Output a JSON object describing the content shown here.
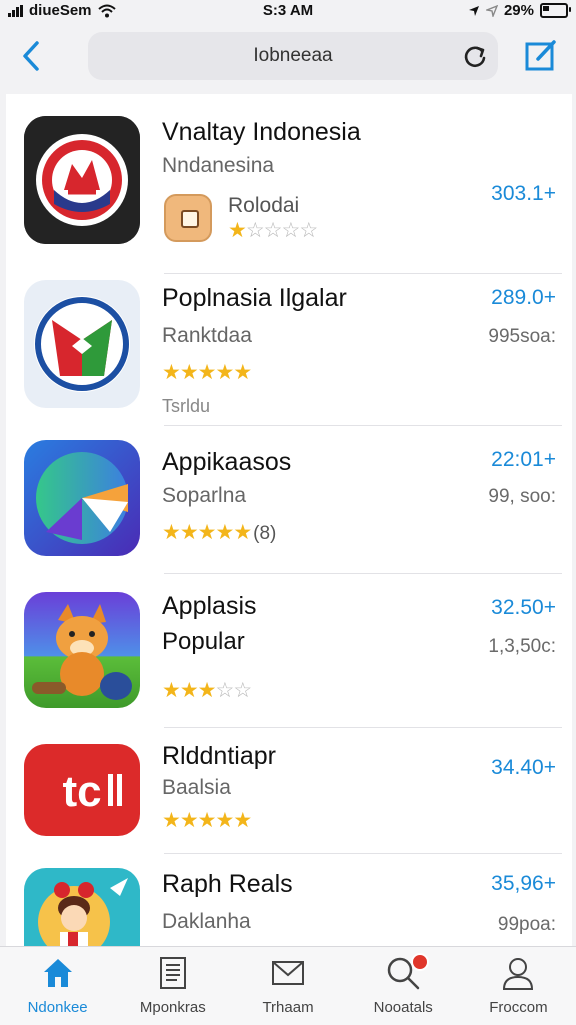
{
  "status_bar": {
    "carrier": "diueSem",
    "time": "S:3 AM",
    "battery": "29%",
    "battery_level": 0.29
  },
  "nav": {
    "address": "Iobneeaa"
  },
  "apps": [
    {
      "name": "Vnaltay Indonesia",
      "subtitle": "Nndanesina",
      "badge_label": "Rolodai",
      "price": "303.1+",
      "rating": 1,
      "icon": "red-circle-logo-icon"
    },
    {
      "name": "Poplnasia Ilgalar",
      "subtitle": "Ranktdaa",
      "price": "289.0+",
      "downloads": "995soa:",
      "extra_text": "Tsrldu",
      "rating": 4.5,
      "icon": "red-green-badge-icon"
    },
    {
      "name": "Appikaasos",
      "subtitle": "Soparlna",
      "price": "22:01+",
      "downloads": "99, soo:",
      "rating": 4.5,
      "rating_text": "(8)",
      "icon": "gradient-arrow-icon"
    },
    {
      "name": "Applasis",
      "subtitle": "Popular",
      "price": "32.50+",
      "downloads": "1,3,50c:",
      "rating": 2.5,
      "icon": "fox-character-icon"
    },
    {
      "name": "Rlddntiapr",
      "subtitle": "Baalsia",
      "price": "34.40+",
      "rating": 4.5,
      "icon": "tc-logo-icon"
    },
    {
      "name": "Raph Reals",
      "subtitle": "Daklanha",
      "price": "35,96+",
      "downloads": "99poa:",
      "icon": "cartoon-girl-icon"
    }
  ],
  "tabs": [
    {
      "label": "Ndonkee",
      "icon": "home-icon",
      "active": true
    },
    {
      "label": "Mponkras",
      "icon": "list-icon"
    },
    {
      "label": "Trhaam",
      "icon": "mail-icon"
    },
    {
      "label": "Nooatals",
      "icon": "search-icon",
      "notification": true
    },
    {
      "label": "Froccom",
      "icon": "profile-icon"
    }
  ],
  "colors": {
    "accent": "#1a8ad8",
    "star": "#f3b51a",
    "notification": "#e0362b"
  }
}
